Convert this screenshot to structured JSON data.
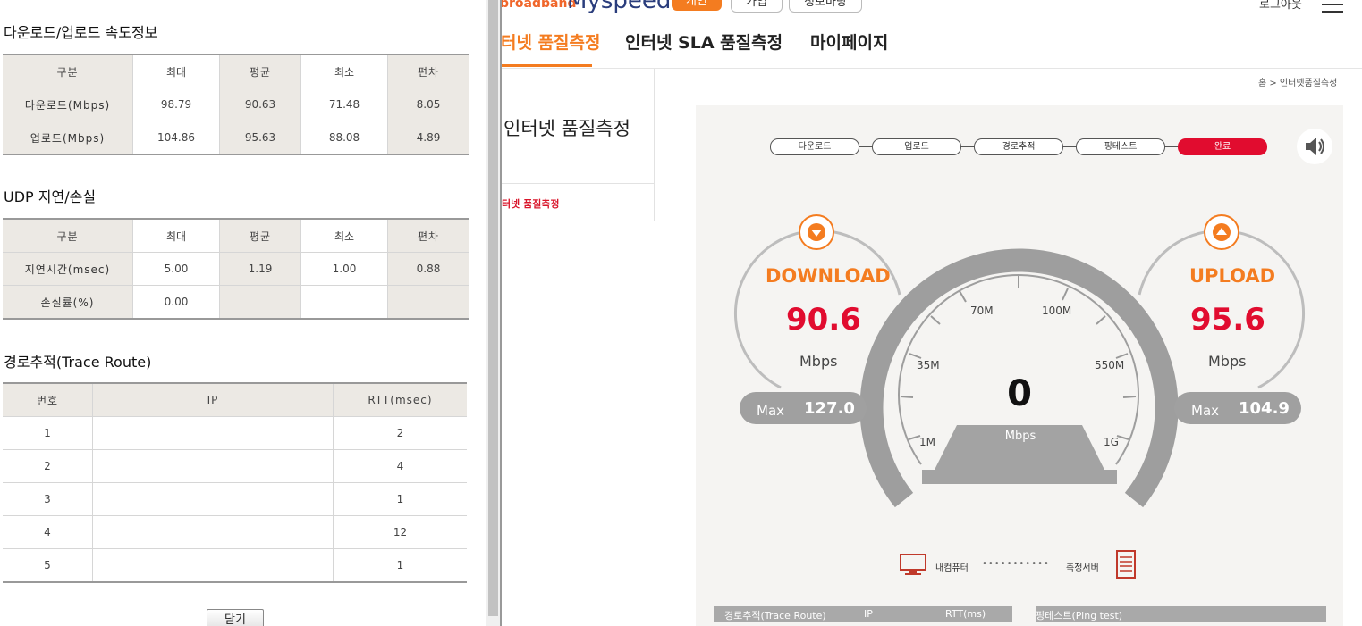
{
  "header": {
    "logo_sub": "broadband",
    "logo_main": "Myspeed",
    "btn_open": "개인",
    "btn_join": "가입",
    "btn_info": "정보마당",
    "logout": "로그아웃",
    "nav": [
      "터넷 품질측정",
      "인터넷 SLA 품질측정",
      "마이페이지"
    ],
    "breadcrumb": "홈  >  인터넷품질측정"
  },
  "side": {
    "title": "인터넷 품질측정",
    "link": "터넷 품질측정"
  },
  "steps": [
    "다운로드",
    "업로드",
    "경로추적",
    "핑테스트",
    "완료"
  ],
  "download": {
    "label": "DOWNLOAD",
    "value": "90.6",
    "unit": "Mbps",
    "max_label": "Max",
    "max_value": "127.0"
  },
  "upload": {
    "label": "UPLOAD",
    "value": "95.6",
    "unit": "Mbps",
    "max_label": "Max",
    "max_value": "104.9"
  },
  "gauge": {
    "value": "0",
    "unit": "Mbps",
    "ticks": [
      "1M",
      "35M",
      "70M",
      "100M",
      "550M",
      "1G"
    ]
  },
  "connection": {
    "pc": "내컴퓨터",
    "dots": "•••••••••••",
    "server": "측정서버"
  },
  "bottom": {
    "trace_head": [
      "경로추적(Trace Route)",
      "IP",
      "RTT(ms)"
    ],
    "ping_head": "핑테스트(Ping test)"
  },
  "popup": {
    "speed_title": "다운로드/업로드 속도정보",
    "speed_headers": [
      "구분",
      "최대",
      "평균",
      "최소",
      "편차"
    ],
    "speed_rows": [
      {
        "label": "다운로드(Mbps)",
        "max": "98.79",
        "avg": "90.63",
        "min": "71.48",
        "dev": "8.05"
      },
      {
        "label": "업로드(Mbps)",
        "max": "104.86",
        "avg": "95.63",
        "min": "88.08",
        "dev": "4.89"
      }
    ],
    "udp_title": "UDP 지연/손실",
    "udp_headers": [
      "구분",
      "최대",
      "평균",
      "최소",
      "편차"
    ],
    "udp_rows": [
      {
        "label": "지연시간(msec)",
        "max": "5.00",
        "avg": "1.19",
        "min": "1.00",
        "dev": "0.88"
      },
      {
        "label": "손실률(%)",
        "max": "0.00",
        "avg": "",
        "min": "",
        "dev": ""
      }
    ],
    "trace_title": "경로추적(Trace Route)",
    "trace_headers": [
      "번호",
      "IP",
      "RTT(msec)"
    ],
    "trace_rows": [
      {
        "no": "1",
        "ip": "",
        "rtt": "2"
      },
      {
        "no": "2",
        "ip": "",
        "rtt": "4"
      },
      {
        "no": "3",
        "ip": "",
        "rtt": "1"
      },
      {
        "no": "4",
        "ip": "",
        "rtt": "12"
      },
      {
        "no": "5",
        "ip": "",
        "rtt": "1"
      }
    ],
    "close": "닫기"
  },
  "colors": {
    "accent": "#f47c20",
    "red": "#e10c2f",
    "gauge_gray": "#a0a0a0"
  }
}
